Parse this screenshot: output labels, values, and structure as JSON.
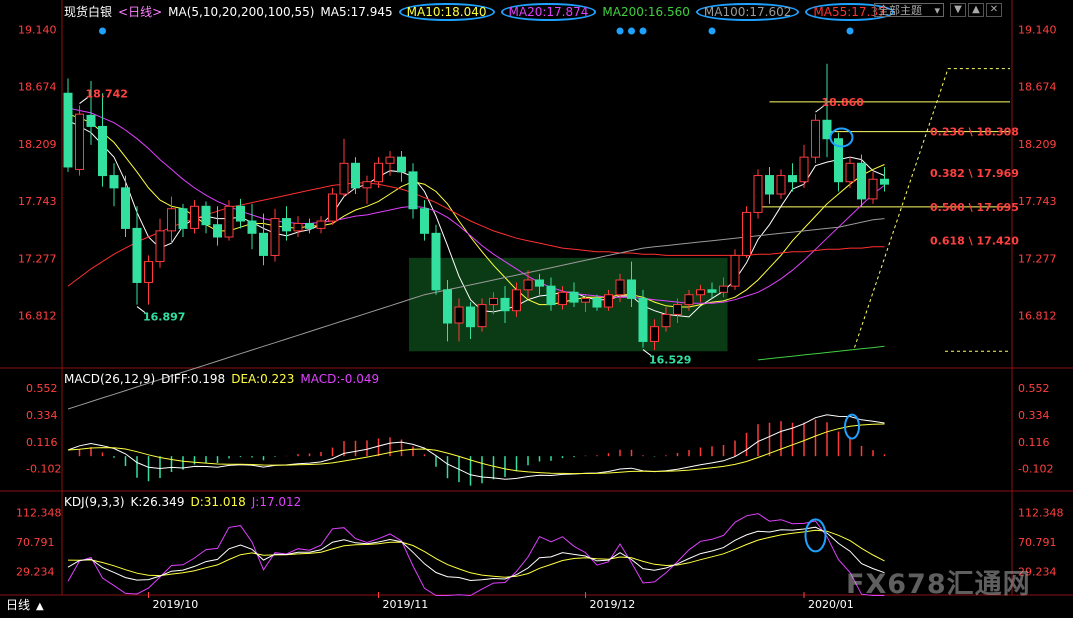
{
  "toolbar": {
    "instrument": "现货白银",
    "period_tag": "<日线>",
    "ma_params": "MA(5,10,20,200,100,55)",
    "ma5": "MA5:17.945",
    "ma10": "MA10:18.040",
    "ma20": "MA20:17.874",
    "ma200": "MA200:16.560",
    "ma100": "MA100:17.602",
    "ma55": "MA55:17.37",
    "dropdown": "全部主题",
    "btn_down": "▼",
    "btn_up": "▲",
    "btn_close": "✕"
  },
  "colors": {
    "up": "#ff3b3b",
    "down": "#33e0a0",
    "ma5": "#ffffff",
    "ma10": "#ffff40",
    "ma20": "#e040ff",
    "ma200": "#40d040",
    "ma100": "#9a9a9a",
    "ma55": "#ff3030",
    "highlight": "#1fa2ff",
    "fib": "#ffff60",
    "fib_text": "#ff4040"
  },
  "macd": {
    "title": "MACD(26,12,9)",
    "diff": "DIFF:0.198",
    "dea": "DEA:0.223",
    "macd": "MACD:-0.049"
  },
  "kdj": {
    "title": "KDJ(9,3,3)",
    "k": "K:26.349",
    "d": "D:31.018",
    "j": "J:17.012"
  },
  "footer": {
    "period_label": "日线",
    "arrow": "▲"
  },
  "watermark": "FX678汇通网",
  "chart_data": [
    {
      "type": "candlestick",
      "title": "现货白银 日线",
      "y_ticks": [
        "19.140",
        "18.674",
        "18.209",
        "17.743",
        "17.277",
        "16.812"
      ],
      "ylim": [
        16.4,
        19.2
      ],
      "x_tick_labels": [
        "2019/10",
        "2019/11",
        "2019/12",
        "2020/01"
      ],
      "annotations": [
        {
          "text": "18.742",
          "kind": "high"
        },
        {
          "text": "16.897",
          "kind": "low"
        },
        {
          "text": "16.529",
          "kind": "low"
        },
        {
          "text": "18.860",
          "kind": "high"
        }
      ],
      "fib_levels": [
        {
          "label": "0.236 \\ 18.308",
          "value": 18.308
        },
        {
          "label": "0.382 \\ 17.969",
          "value": 17.969
        },
        {
          "label": "0.500 \\ 17.695",
          "value": 17.695
        },
        {
          "label": "0.618 \\ 17.420",
          "value": 17.42
        }
      ],
      "candles": [
        {
          "o": 18.62,
          "h": 18.74,
          "l": 17.98,
          "c": 18.02
        },
        {
          "o": 18.0,
          "h": 18.52,
          "l": 17.95,
          "c": 18.45
        },
        {
          "o": 18.44,
          "h": 18.72,
          "l": 18.2,
          "c": 18.35
        },
        {
          "o": 18.35,
          "h": 18.62,
          "l": 17.86,
          "c": 17.95
        },
        {
          "o": 17.95,
          "h": 18.05,
          "l": 17.7,
          "c": 17.85
        },
        {
          "o": 17.85,
          "h": 17.95,
          "l": 17.45,
          "c": 17.52
        },
        {
          "o": 17.52,
          "h": 17.7,
          "l": 16.9,
          "c": 17.08
        },
        {
          "o": 17.08,
          "h": 17.3,
          "l": 16.9,
          "c": 17.25
        },
        {
          "o": 17.25,
          "h": 17.6,
          "l": 17.2,
          "c": 17.5
        },
        {
          "o": 17.5,
          "h": 17.78,
          "l": 17.4,
          "c": 17.68
        },
        {
          "o": 17.68,
          "h": 17.72,
          "l": 17.45,
          "c": 17.52
        },
        {
          "o": 17.52,
          "h": 17.75,
          "l": 17.48,
          "c": 17.7
        },
        {
          "o": 17.7,
          "h": 17.74,
          "l": 17.48,
          "c": 17.55
        },
        {
          "o": 17.55,
          "h": 17.7,
          "l": 17.38,
          "c": 17.45
        },
        {
          "o": 17.45,
          "h": 17.75,
          "l": 17.42,
          "c": 17.7
        },
        {
          "o": 17.7,
          "h": 17.76,
          "l": 17.52,
          "c": 17.58
        },
        {
          "o": 17.58,
          "h": 17.72,
          "l": 17.35,
          "c": 17.48
        },
        {
          "o": 17.48,
          "h": 17.64,
          "l": 17.22,
          "c": 17.3
        },
        {
          "o": 17.3,
          "h": 17.68,
          "l": 17.25,
          "c": 17.6
        },
        {
          "o": 17.6,
          "h": 17.7,
          "l": 17.42,
          "c": 17.5
        },
        {
          "o": 17.5,
          "h": 17.62,
          "l": 17.45,
          "c": 17.56
        },
        {
          "o": 17.56,
          "h": 17.6,
          "l": 17.48,
          "c": 17.52
        },
        {
          "o": 17.52,
          "h": 17.62,
          "l": 17.48,
          "c": 17.58
        },
        {
          "o": 17.58,
          "h": 17.85,
          "l": 17.55,
          "c": 17.8
        },
        {
          "o": 17.8,
          "h": 18.25,
          "l": 17.78,
          "c": 18.05
        },
        {
          "o": 18.05,
          "h": 18.1,
          "l": 17.8,
          "c": 17.85
        },
        {
          "o": 17.85,
          "h": 17.95,
          "l": 17.72,
          "c": 17.9
        },
        {
          "o": 17.9,
          "h": 18.1,
          "l": 17.85,
          "c": 18.05
        },
        {
          "o": 18.05,
          "h": 18.15,
          "l": 17.95,
          "c": 18.1
        },
        {
          "o": 18.1,
          "h": 18.15,
          "l": 17.9,
          "c": 17.98
        },
        {
          "o": 17.98,
          "h": 18.05,
          "l": 17.6,
          "c": 17.68
        },
        {
          "o": 17.68,
          "h": 17.75,
          "l": 17.42,
          "c": 17.48
        },
        {
          "o": 17.48,
          "h": 17.55,
          "l": 16.98,
          "c": 17.02
        },
        {
          "o": 17.02,
          "h": 17.1,
          "l": 16.6,
          "c": 16.75
        },
        {
          "o": 16.75,
          "h": 16.95,
          "l": 16.6,
          "c": 16.88
        },
        {
          "o": 16.88,
          "h": 16.92,
          "l": 16.62,
          "c": 16.72
        },
        {
          "o": 16.72,
          "h": 16.95,
          "l": 16.68,
          "c": 16.9
        },
        {
          "o": 16.9,
          "h": 17.0,
          "l": 16.82,
          "c": 16.95
        },
        {
          "o": 16.95,
          "h": 17.05,
          "l": 16.75,
          "c": 16.85
        },
        {
          "o": 16.85,
          "h": 17.08,
          "l": 16.8,
          "c": 17.02
        },
        {
          "o": 17.02,
          "h": 17.18,
          "l": 16.95,
          "c": 17.1
        },
        {
          "o": 17.1,
          "h": 17.15,
          "l": 16.98,
          "c": 17.05
        },
        {
          "o": 17.05,
          "h": 17.12,
          "l": 16.85,
          "c": 16.9
        },
        {
          "o": 16.9,
          "h": 17.05,
          "l": 16.86,
          "c": 17.0
        },
        {
          "o": 17.0,
          "h": 17.08,
          "l": 16.88,
          "c": 16.92
        },
        {
          "o": 16.92,
          "h": 16.98,
          "l": 16.84,
          "c": 16.95
        },
        {
          "o": 16.95,
          "h": 16.98,
          "l": 16.85,
          "c": 16.88
        },
        {
          "o": 16.88,
          "h": 17.02,
          "l": 16.85,
          "c": 16.98
        },
        {
          "o": 16.98,
          "h": 17.15,
          "l": 16.92,
          "c": 17.1
        },
        {
          "o": 17.1,
          "h": 17.25,
          "l": 16.88,
          "c": 16.95
        },
        {
          "o": 16.95,
          "h": 17.02,
          "l": 16.55,
          "c": 16.6
        },
        {
          "o": 16.6,
          "h": 16.78,
          "l": 16.53,
          "c": 16.72
        },
        {
          "o": 16.72,
          "h": 16.88,
          "l": 16.68,
          "c": 16.82
        },
        {
          "o": 16.82,
          "h": 16.95,
          "l": 16.75,
          "c": 16.9
        },
        {
          "o": 16.9,
          "h": 17.02,
          "l": 16.85,
          "c": 16.98
        },
        {
          "o": 16.98,
          "h": 17.06,
          "l": 16.92,
          "c": 17.02
        },
        {
          "o": 17.02,
          "h": 17.08,
          "l": 16.95,
          "c": 17.0
        },
        {
          "o": 17.0,
          "h": 17.12,
          "l": 16.96,
          "c": 17.05
        },
        {
          "o": 17.05,
          "h": 17.35,
          "l": 17.02,
          "c": 17.3
        },
        {
          "o": 17.3,
          "h": 17.7,
          "l": 17.28,
          "c": 17.65
        },
        {
          "o": 17.65,
          "h": 18.0,
          "l": 17.6,
          "c": 17.95
        },
        {
          "o": 17.95,
          "h": 18.02,
          "l": 17.72,
          "c": 17.8
        },
        {
          "o": 17.8,
          "h": 18.0,
          "l": 17.76,
          "c": 17.95
        },
        {
          "o": 17.95,
          "h": 18.05,
          "l": 17.82,
          "c": 17.9
        },
        {
          "o": 17.9,
          "h": 18.2,
          "l": 17.85,
          "c": 18.1
        },
        {
          "o": 18.1,
          "h": 18.45,
          "l": 18.05,
          "c": 18.4
        },
        {
          "o": 18.4,
          "h": 18.86,
          "l": 18.1,
          "c": 18.25
        },
        {
          "o": 18.25,
          "h": 18.3,
          "l": 17.82,
          "c": 17.9
        },
        {
          "o": 17.9,
          "h": 18.1,
          "l": 17.85,
          "c": 18.05
        },
        {
          "o": 18.05,
          "h": 18.12,
          "l": 17.7,
          "c": 17.76
        },
        {
          "o": 17.76,
          "h": 17.98,
          "l": 17.72,
          "c": 17.92
        },
        {
          "o": 17.92,
          "h": 18.02,
          "l": 17.82,
          "c": 17.88
        }
      ],
      "ma_lines": [
        {
          "name": "MA5",
          "values": [
            18.4,
            18.35,
            18.3,
            18.2,
            18.1,
            17.9,
            17.65,
            17.45,
            17.36,
            17.4,
            17.54,
            17.6,
            17.62,
            17.6,
            17.6,
            17.61,
            17.57,
            17.52,
            17.48,
            17.46,
            17.49,
            17.51,
            17.55,
            17.64,
            17.78,
            17.85,
            17.88,
            17.94,
            17.99,
            17.98,
            17.94,
            17.82,
            17.62,
            17.38,
            17.13,
            16.94,
            16.85,
            16.84,
            16.86,
            16.89,
            16.94,
            16.97,
            16.98,
            17.0,
            17.0,
            16.96,
            16.94,
            16.94,
            16.97,
            16.97,
            16.89,
            16.85,
            16.82,
            16.81,
            16.8,
            16.89,
            16.95,
            17.01,
            17.1,
            17.24,
            17.43,
            17.55,
            17.7,
            17.84,
            17.88,
            18.03,
            18.06,
            18.08,
            18.1,
            18.08,
            17.99,
            17.95
          ]
        },
        {
          "name": "MA10",
          "values": [
            18.45,
            18.42,
            18.38,
            18.3,
            18.22,
            18.1,
            17.98,
            17.85,
            17.75,
            17.7,
            17.68,
            17.62,
            17.55,
            17.5,
            17.5,
            17.53,
            17.56,
            17.56,
            17.54,
            17.53,
            17.52,
            17.54,
            17.54,
            17.56,
            17.62,
            17.67,
            17.7,
            17.74,
            17.8,
            17.86,
            17.9,
            17.88,
            17.82,
            17.72,
            17.58,
            17.45,
            17.33,
            17.22,
            17.12,
            17.02,
            16.94,
            16.9,
            16.9,
            16.92,
            16.94,
            16.96,
            16.96,
            16.96,
            16.98,
            16.98,
            16.96,
            16.92,
            16.89,
            16.88,
            16.88,
            16.9,
            16.92,
            16.93,
            16.96,
            17.02,
            17.1,
            17.2,
            17.3,
            17.42,
            17.52,
            17.62,
            17.72,
            17.8,
            17.88,
            17.95,
            18.0,
            18.04
          ]
        },
        {
          "name": "MA20",
          "values": [
            18.5,
            18.48,
            18.46,
            18.42,
            18.38,
            18.32,
            18.25,
            18.17,
            18.08,
            18.0,
            17.92,
            17.85,
            17.79,
            17.74,
            17.7,
            17.66,
            17.63,
            17.6,
            17.58,
            17.57,
            17.56,
            17.56,
            17.57,
            17.58,
            17.6,
            17.62,
            17.63,
            17.65,
            17.67,
            17.69,
            17.7,
            17.69,
            17.66,
            17.61,
            17.54,
            17.46,
            17.38,
            17.31,
            17.25,
            17.19,
            17.13,
            17.08,
            17.04,
            17.01,
            16.99,
            16.98,
            16.97,
            16.96,
            16.96,
            16.96,
            16.95,
            16.94,
            16.93,
            16.92,
            16.91,
            16.91,
            16.91,
            16.92,
            16.94,
            16.97,
            17.0,
            17.05,
            17.11,
            17.18,
            17.26,
            17.35,
            17.44,
            17.53,
            17.62,
            17.71,
            17.8,
            17.87
          ]
        },
        {
          "name": "MA55",
          "values": [
            17.05,
            17.12,
            17.19,
            17.25,
            17.31,
            17.36,
            17.41,
            17.45,
            17.49,
            17.53,
            17.57,
            17.6,
            17.63,
            17.66,
            17.69,
            17.71,
            17.73,
            17.75,
            17.77,
            17.79,
            17.81,
            17.83,
            17.85,
            17.87,
            17.88,
            17.89,
            17.89,
            17.88,
            17.86,
            17.84,
            17.81,
            17.77,
            17.73,
            17.68,
            17.63,
            17.58,
            17.54,
            17.5,
            17.47,
            17.44,
            17.42,
            17.4,
            17.38,
            17.36,
            17.35,
            17.34,
            17.33,
            17.33,
            17.32,
            17.32,
            17.31,
            17.31,
            17.3,
            17.3,
            17.3,
            17.3,
            17.3,
            17.3,
            17.3,
            17.3,
            17.31,
            17.31,
            17.32,
            17.33,
            17.33,
            17.34,
            17.35,
            17.35,
            17.36,
            17.36,
            17.37,
            17.37
          ]
        },
        {
          "name": "MA100",
          "values": [
            16.05,
            16.08,
            16.11,
            16.14,
            16.17,
            16.2,
            16.23,
            16.26,
            16.29,
            16.32,
            16.35,
            16.38,
            16.41,
            16.44,
            16.47,
            16.5,
            16.53,
            16.56,
            16.59,
            16.62,
            16.65,
            16.68,
            16.71,
            16.74,
            16.77,
            16.8,
            16.83,
            16.86,
            16.89,
            16.92,
            16.95,
            16.98,
            17.0,
            17.02,
            17.04,
            17.06,
            17.08,
            17.1,
            17.12,
            17.14,
            17.16,
            17.18,
            17.2,
            17.22,
            17.24,
            17.26,
            17.28,
            17.3,
            17.32,
            17.34,
            17.36,
            17.37,
            17.38,
            17.39,
            17.4,
            17.41,
            17.42,
            17.43,
            17.44,
            17.45,
            17.46,
            17.47,
            17.48,
            17.49,
            17.5,
            17.51,
            17.52,
            17.53,
            17.55,
            17.57,
            17.59,
            17.6
          ]
        },
        {
          "name": "MA200",
          "values": [
            null,
            null,
            null,
            null,
            null,
            null,
            null,
            null,
            null,
            null,
            null,
            null,
            null,
            null,
            null,
            null,
            null,
            null,
            null,
            null,
            null,
            null,
            null,
            null,
            null,
            null,
            null,
            null,
            null,
            null,
            null,
            null,
            null,
            null,
            null,
            null,
            null,
            null,
            null,
            null,
            null,
            null,
            null,
            null,
            null,
            null,
            null,
            null,
            null,
            null,
            null,
            null,
            null,
            null,
            null,
            null,
            null,
            null,
            null,
            null,
            16.45,
            16.46,
            16.47,
            16.48,
            16.49,
            16.5,
            16.51,
            16.52,
            16.53,
            16.54,
            16.55,
            16.56
          ]
        }
      ],
      "markers": [
        3,
        48,
        49,
        50,
        56,
        68
      ]
    },
    {
      "type": "macd",
      "title": "MACD(26,12,9)",
      "y_ticks": [
        "0.552",
        "0.334",
        "0.116",
        "-0.102"
      ],
      "ylim": [
        -0.25,
        0.65
      ]
    },
    {
      "type": "kdj",
      "title": "KDJ(9,3,3)",
      "y_ticks": [
        "112.348",
        "70.791",
        "29.234"
      ],
      "ylim": [
        0,
        130
      ]
    }
  ]
}
